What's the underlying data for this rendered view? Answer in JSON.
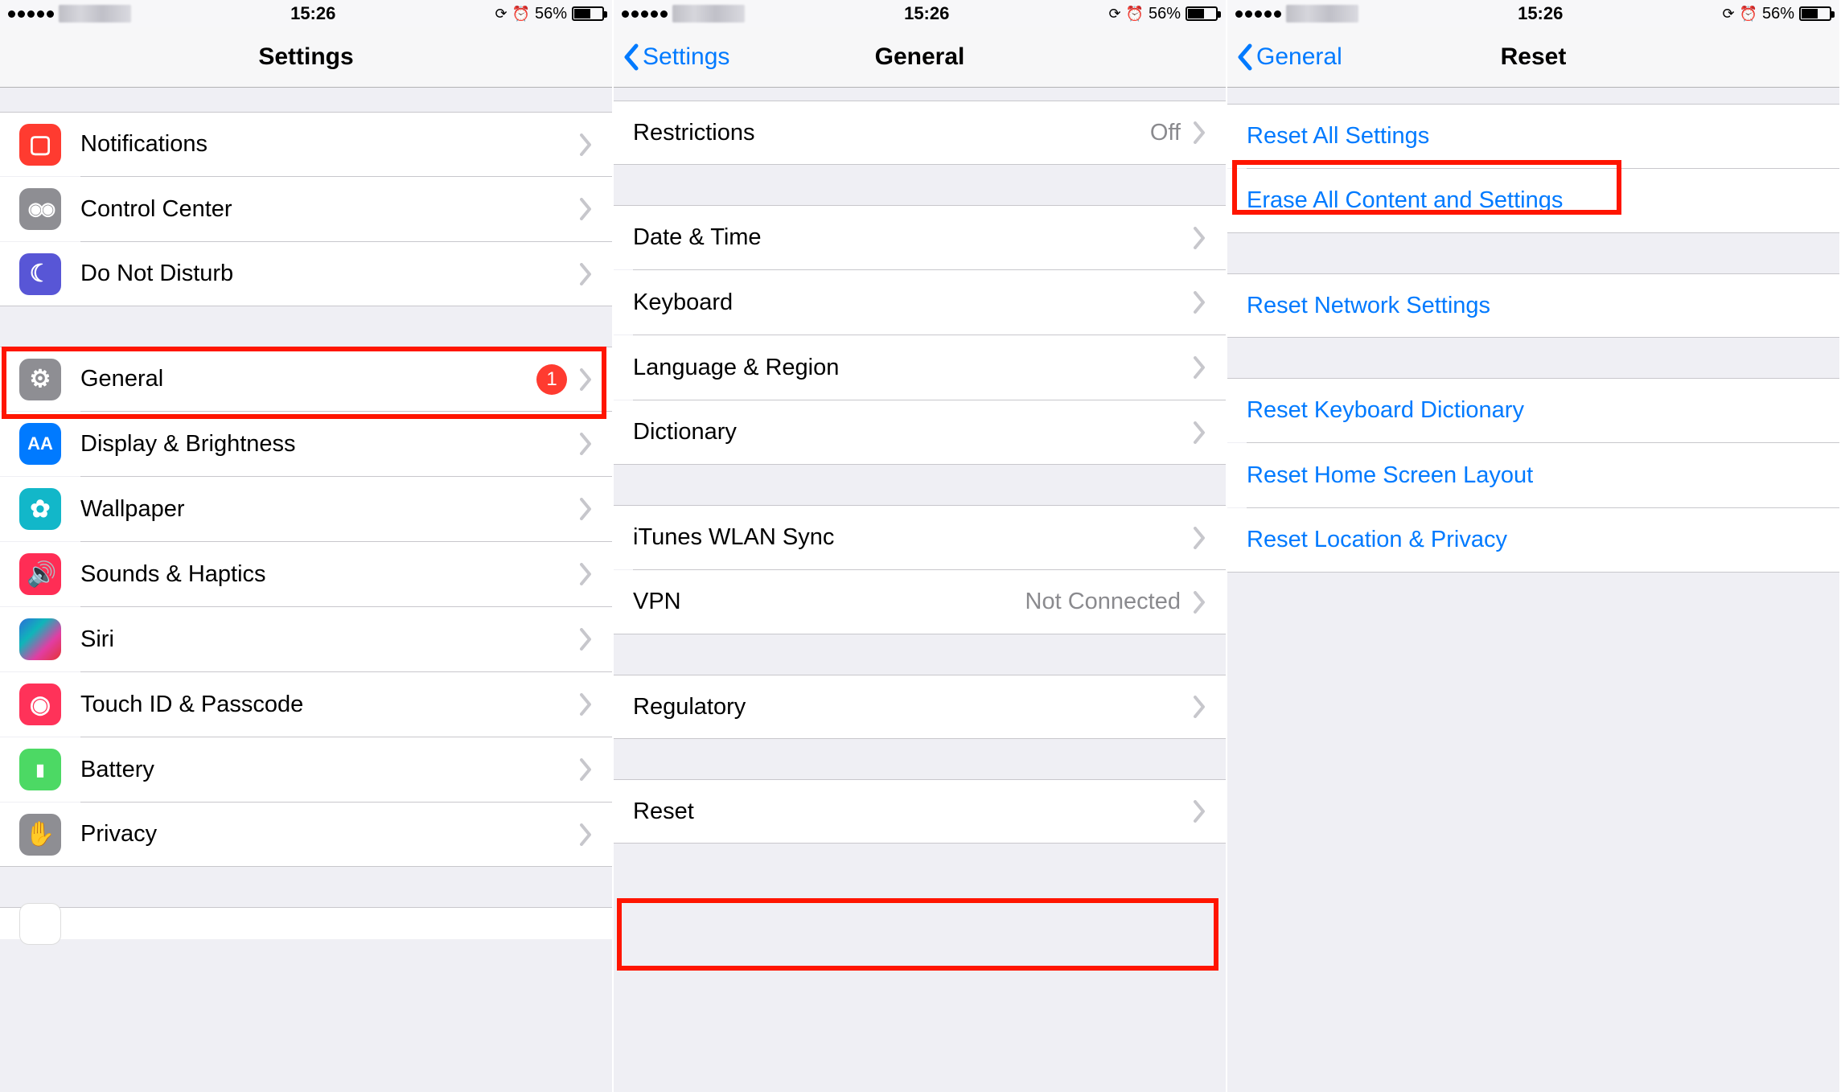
{
  "status": {
    "time": "15:26",
    "battery_pct": "56%"
  },
  "screens": {
    "settings": {
      "title": "Settings",
      "items": {
        "notifications": "Notifications",
        "control_center": "Control Center",
        "dnd": "Do Not Disturb",
        "general": "General",
        "general_badge": "1",
        "display": "Display & Brightness",
        "wallpaper": "Wallpaper",
        "sounds": "Sounds & Haptics",
        "siri": "Siri",
        "touchid": "Touch ID & Passcode",
        "battery": "Battery",
        "privacy": "Privacy"
      }
    },
    "general": {
      "back": "Settings",
      "title": "General",
      "items": {
        "restrictions": "Restrictions",
        "restrictions_value": "Off",
        "datetime": "Date & Time",
        "keyboard": "Keyboard",
        "lang": "Language & Region",
        "dictionary": "Dictionary",
        "itunes": "iTunes WLAN Sync",
        "vpn": "VPN",
        "vpn_value": "Not Connected",
        "regulatory": "Regulatory",
        "reset": "Reset"
      }
    },
    "reset": {
      "back": "General",
      "title": "Reset",
      "items": {
        "reset_all": "Reset All Settings",
        "erase_all": "Erase All Content and Settings",
        "reset_network": "Reset Network Settings",
        "reset_keyboard": "Reset Keyboard Dictionary",
        "reset_home": "Reset Home Screen Layout",
        "reset_location": "Reset Location & Privacy"
      }
    }
  }
}
